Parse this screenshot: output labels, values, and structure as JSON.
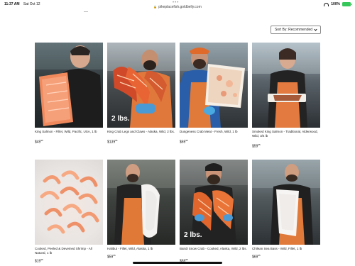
{
  "status_bar": {
    "time": "11:37 AM",
    "date": "Sat Oct 12",
    "url": "pikeplacefish.goldbelly.com",
    "battery_label": "100%",
    "icons": [
      "lock-icon",
      "wifi-icon",
      "battery-icon"
    ],
    "battery_color": "#35c759"
  },
  "sort": {
    "label": "Sort By: Recommended"
  },
  "products": [
    {
      "name": "King Salmon - Fillet, Wild, Pacific, USA, 1 lb",
      "price_main": "$49",
      "price_cents": "95"
    },
    {
      "name": "King Crab Legs and Claws - Alaska, Wild, 2 lbs.",
      "price_main": "$139",
      "price_cents": "95",
      "overlay": "2 lbs."
    },
    {
      "name": "Dungeness Crab Meat - Fresh, Wild, 1 lb",
      "price_main": "$69",
      "price_cents": "95"
    },
    {
      "name": "Smoked King Salmon - Traditional, Alderwood, Wild, 3/4 lb",
      "price_main": "$59",
      "price_cents": "95"
    },
    {
      "name": "Cooked, Peeled & Deveined Shrimp - All Natural, 1 lb",
      "price_main": "$19",
      "price_cents": "95"
    },
    {
      "name": "Halibut - Fillet, Wild, Alaska, 1 lb",
      "price_main": "$59",
      "price_cents": "95"
    },
    {
      "name": "Bairdi Snow Crab - Cooked, Alaska, Wild, 2 lbs.",
      "price_main": "$59",
      "price_cents": "95",
      "overlay": "2 lbs."
    },
    {
      "name": "Chilean Sea Bass - Wild, Fillet, 1 lb",
      "price_main": "$69",
      "price_cents": "95"
    }
  ]
}
